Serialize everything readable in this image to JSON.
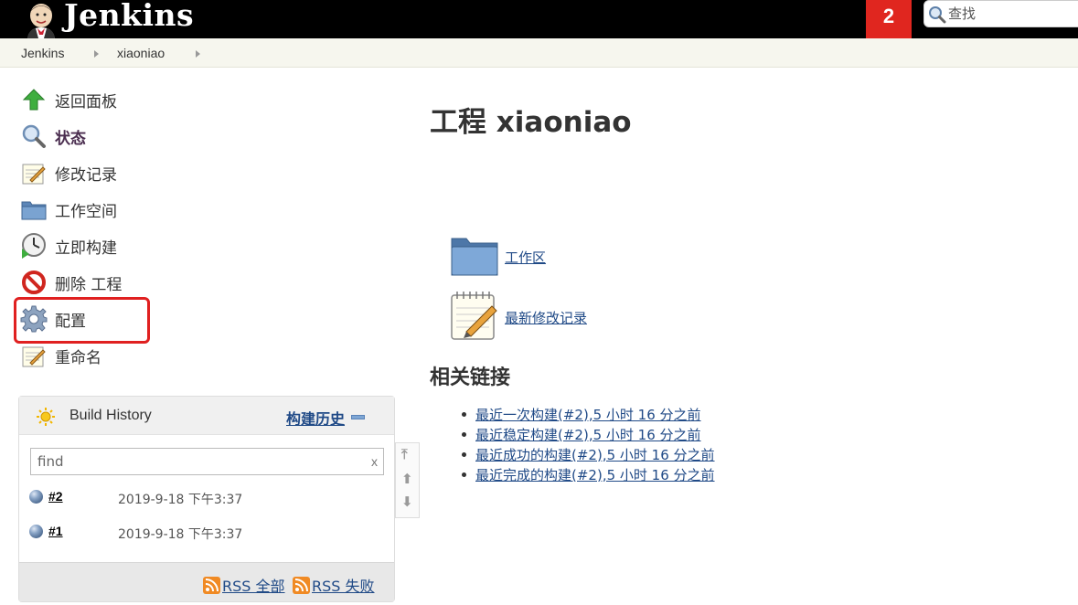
{
  "header": {
    "brand": "Jenkins",
    "notification_count": "2",
    "search_placeholder": "查找"
  },
  "breadcrumb": [
    "Jenkins",
    "xiaoniao"
  ],
  "sidebar": {
    "tasks": [
      {
        "label": "返回面板",
        "icon": "up-arrow-icon"
      },
      {
        "label": "状态",
        "icon": "magnifier-icon"
      },
      {
        "label": "修改记录",
        "icon": "notepad-icon"
      },
      {
        "label": "工作空间",
        "icon": "folder-icon"
      },
      {
        "label": "立即构建",
        "icon": "clock-build-icon"
      },
      {
        "label": "删除 工程",
        "icon": "no-entry-icon"
      },
      {
        "label": "配置",
        "icon": "gear-icon"
      },
      {
        "label": "重命名",
        "icon": "notepad-icon"
      }
    ],
    "highlight_color": "#e02020"
  },
  "build_history": {
    "title": "Build History",
    "trend_link": "构建历史",
    "find_placeholder": "find",
    "clear_label": "x",
    "builds": [
      {
        "number": "#2",
        "date": "2019-9-18 下午3:37"
      },
      {
        "number": "#1",
        "date": "2019-9-18 下午3:37"
      }
    ],
    "rss_all": "RSS 全部",
    "rss_failed": "RSS 失败"
  },
  "main": {
    "title": "工程 xiaoniao",
    "workspace_link": "工作区",
    "changes_link": "最新修改记录",
    "related_heading": "相关链接",
    "related_links": [
      "最近一次构建(#2),5 小时 16 分之前",
      "最近稳定构建(#2),5 小时 16 分之前",
      "最近成功的构建(#2),5 小时 16 分之前",
      "最近完成的构建(#2),5 小时 16 分之前"
    ]
  },
  "colors": {
    "header_bg": "#000000",
    "notification_bg": "#e0261f",
    "link": "#204a87",
    "breadcrumb_bg": "#f6f6ee"
  }
}
